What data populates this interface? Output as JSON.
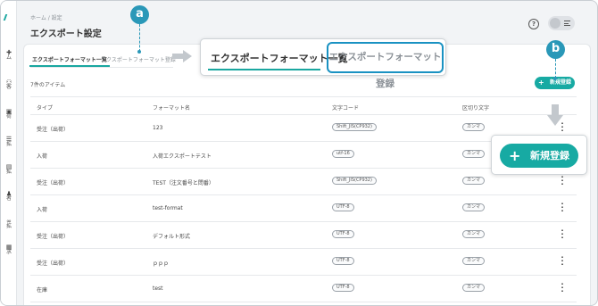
{
  "rail": {
    "items": [
      {
        "icon": "plus-icon",
        "glyph": "✚",
        "label": "ム"
      },
      {
        "icon": "people-icon",
        "glyph": "⚇",
        "label": "客"
      },
      {
        "icon": "box-icon",
        "glyph": "▣",
        "label": "荷"
      },
      {
        "icon": "list-icon",
        "glyph": "☰",
        "label": "拡"
      },
      {
        "icon": "truck-icon",
        "glyph": "▤",
        "label": "拡"
      },
      {
        "icon": "person-icon",
        "glyph": "♟",
        "label": "者"
      },
      {
        "icon": "link-icon",
        "glyph": "∞",
        "label": "拡"
      },
      {
        "icon": "doc-icon",
        "glyph": "▦",
        "label": "求"
      }
    ]
  },
  "header": {
    "breadcrumb": "ホーム / 設定",
    "title": "エクスポート設定"
  },
  "tabs": {
    "active": "エクスポートフォーマット一覧",
    "inactive": "エクスポートフォーマット登録"
  },
  "list": {
    "count_label": "7件のアイテム",
    "new_button": "新規登録",
    "columns": [
      "タイプ",
      "フォーマット名",
      "文字コード",
      "区切り文字"
    ],
    "rows": [
      {
        "type": "受注（出荷）",
        "name": "123",
        "encoding": "Shift_JIS(CP932)",
        "delimiter": "カンマ"
      },
      {
        "type": "入荷",
        "name": "入荷エクスポートテスト",
        "encoding": "utf-16",
        "delimiter": "カンマ"
      },
      {
        "type": "受注（出荷）",
        "name": "TEST（注文番号と問番）",
        "encoding": "Shift_JIS(CP932)",
        "delimiter": "カンマ"
      },
      {
        "type": "入荷",
        "name": "test-format",
        "encoding": "UTF-8",
        "delimiter": "カンマ"
      },
      {
        "type": "受注（出荷）",
        "name": "デフォルト形式",
        "encoding": "UTF-8",
        "delimiter": "カンマ"
      },
      {
        "type": "受注（出荷）",
        "name": "ｐｐｐ",
        "encoding": "UTF-8",
        "delimiter": "カンマ"
      },
      {
        "type": "在庫",
        "name": "test",
        "encoding": "UTF-8",
        "delimiter": "カンマ"
      }
    ]
  },
  "callouts": {
    "a": "a",
    "b": "b",
    "zoom_tab_active": "エクスポートフォーマット一覧",
    "zoom_tab_inactive": "エクスポートフォーマット登録",
    "zoom_new_button": "新規登録"
  },
  "colors": {
    "accent": "#17aaa3",
    "callout": "#2a98b8",
    "highlight_border": "#1a92c2"
  }
}
